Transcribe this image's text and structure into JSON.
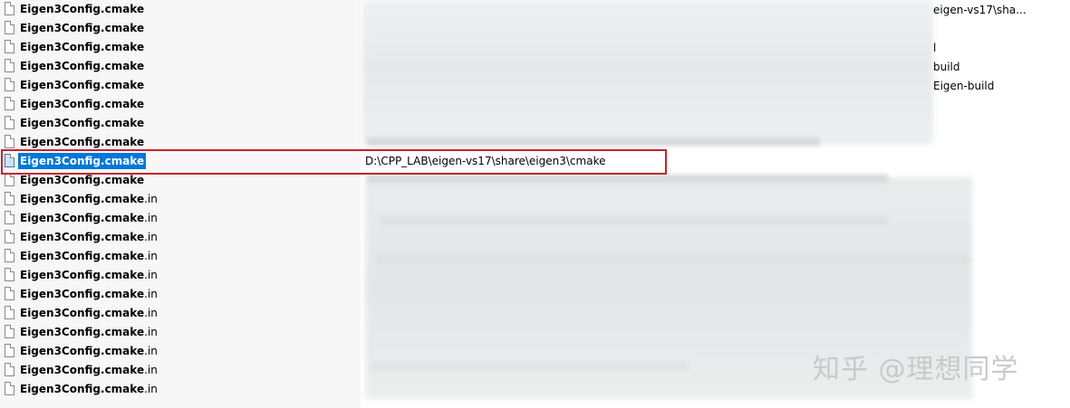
{
  "files": [
    {
      "name": "Eigen3Config",
      "ext": ".cmake",
      "selected": false
    },
    {
      "name": "Eigen3Config",
      "ext": ".cmake",
      "selected": false
    },
    {
      "name": "Eigen3Config",
      "ext": ".cmake",
      "selected": false
    },
    {
      "name": "Eigen3Config",
      "ext": ".cmake",
      "selected": false
    },
    {
      "name": "Eigen3Config",
      "ext": ".cmake",
      "selected": false
    },
    {
      "name": "Eigen3Config",
      "ext": ".cmake",
      "selected": false
    },
    {
      "name": "Eigen3Config",
      "ext": ".cmake",
      "selected": false
    },
    {
      "name": "Eigen3Config",
      "ext": ".cmake",
      "selected": false
    },
    {
      "name": "Eigen3Config",
      "ext": ".cmake",
      "selected": true,
      "path": "D:\\CPP_LAB\\eigen-vs17\\share\\eigen3\\cmake"
    },
    {
      "name": "Eigen3Config",
      "ext": ".cmake",
      "selected": false
    },
    {
      "name": "Eigen3Config.cmake",
      "ext": ".in",
      "selected": false
    },
    {
      "name": "Eigen3Config.cmake",
      "ext": ".in",
      "selected": false
    },
    {
      "name": "Eigen3Config.cmake",
      "ext": ".in",
      "selected": false
    },
    {
      "name": "Eigen3Config.cmake",
      "ext": ".in",
      "selected": false
    },
    {
      "name": "Eigen3Config.cmake",
      "ext": ".in",
      "selected": false
    },
    {
      "name": "Eigen3Config.cmake",
      "ext": ".in",
      "selected": false
    },
    {
      "name": "Eigen3Config.cmake",
      "ext": ".in",
      "selected": false
    },
    {
      "name": "Eigen3Config.cmake",
      "ext": ".in",
      "selected": false
    },
    {
      "name": "Eigen3Config.cmake",
      "ext": ".in",
      "selected": false
    },
    {
      "name": "Eigen3Config.cmake",
      "ext": ".in",
      "selected": false
    },
    {
      "name": "Eigen3Config.cmake",
      "ext": ".in",
      "selected": false
    }
  ],
  "partial_paths": {
    "row0": "eigen-vs17\\sha...",
    "row2": "l",
    "row3": "build",
    "row4": "Eigen-build"
  },
  "watermark": "知乎 @理想同学",
  "colors": {
    "selection": "#0078d7",
    "highlight_frame": "#c4232d"
  }
}
